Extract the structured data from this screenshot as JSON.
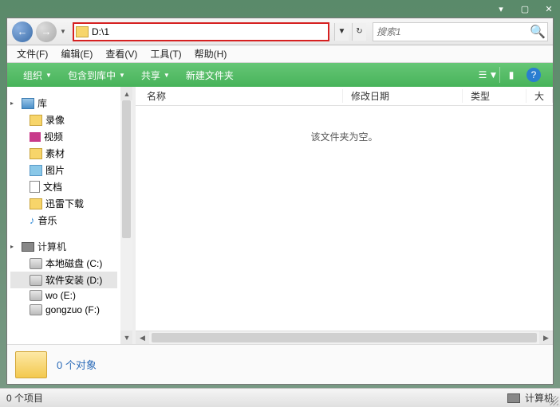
{
  "titlebar": {
    "min": "▾",
    "max": "▢",
    "close": "✕"
  },
  "nav": {
    "back": "←",
    "forward": "→"
  },
  "address": {
    "value": "D:\\1"
  },
  "address_refresh": "↻",
  "search": {
    "placeholder": "搜索1"
  },
  "menu": {
    "file": "文件(F)",
    "edit": "编辑(E)",
    "view": "查看(V)",
    "tools": "工具(T)",
    "help": "帮助(H)"
  },
  "toolbar": {
    "organize": "组织",
    "include": "包含到库中",
    "share": "共享",
    "newfolder": "新建文件夹"
  },
  "columns": {
    "name": "名称",
    "modified": "修改日期",
    "type": "类型",
    "size": "大"
  },
  "empty": "该文件夹为空。",
  "navpane": {
    "library": {
      "label": "库",
      "items": [
        "录像",
        "视频",
        "素材",
        "图片",
        "文档",
        "迅雷下载",
        "音乐"
      ]
    },
    "computer": {
      "label": "计算机",
      "items": [
        "本地磁盘 (C:)",
        "软件安装 (D:)",
        "wo (E:)",
        "gongzuo (F:)"
      ]
    },
    "selected_index": 1
  },
  "details": {
    "count_label": "0 个对象"
  },
  "status": {
    "left": "0 个项目",
    "right": "计算机"
  }
}
